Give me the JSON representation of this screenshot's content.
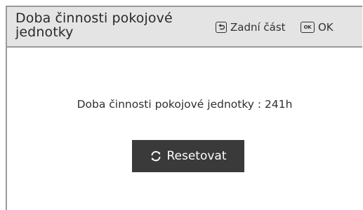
{
  "header": {
    "title": "Doba činnosti pokojové jednotky",
    "back_label": "Zadní část",
    "ok_icon_text": "OK",
    "ok_label": "OK"
  },
  "main": {
    "info_text": "Doba činnosti pokojové jednotky : 241h",
    "reset_label": "Resetovat"
  },
  "icons": {
    "back": "back-arrow-icon",
    "ok": "ok-key-icon",
    "reset": "refresh-icon"
  }
}
